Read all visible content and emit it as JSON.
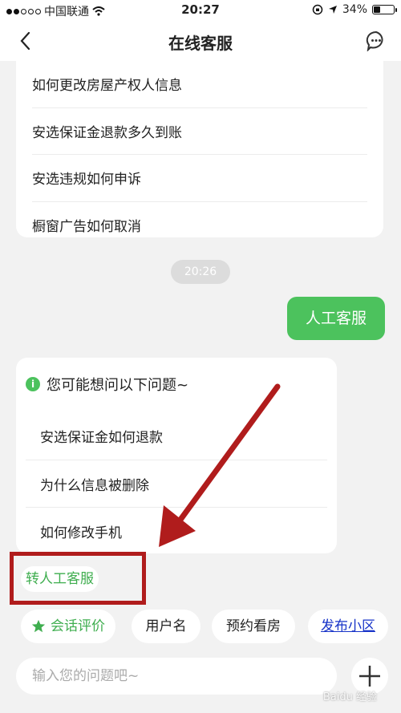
{
  "status_bar": {
    "carrier": "中国联通",
    "time": "20:27",
    "battery": "34%",
    "battery_level": 0.34
  },
  "nav": {
    "title": "在线客服",
    "back_icon": "chevron-left-icon",
    "menu_icon": "chat-bubble-icon"
  },
  "faq": {
    "items": [
      "如何更改房屋产权人信息",
      "安选保证金退款多久到账",
      "安选违规如何申诉",
      "橱窗广告如何取消"
    ]
  },
  "chat": {
    "timestamp": "20:26",
    "user_message": "人工客服"
  },
  "suggestions": {
    "header": "您可能想问以下问题~",
    "icon": "info-icon",
    "items": [
      "安选保证金如何退款",
      "为什么信息被删除",
      "如何修改手机"
    ]
  },
  "transfer_label": "转人工客服",
  "quick_actions": {
    "rate": "会话评价",
    "username": "用户名",
    "book_viewing": "预约看房",
    "publish_community": "发布小区"
  },
  "input": {
    "placeholder": "输入您的问题吧~"
  },
  "watermark": "Baidu 经验",
  "colors": {
    "accent_green": "#4cc25d",
    "annotation_red": "#b01c1c",
    "link_blue": "#1733c8"
  }
}
